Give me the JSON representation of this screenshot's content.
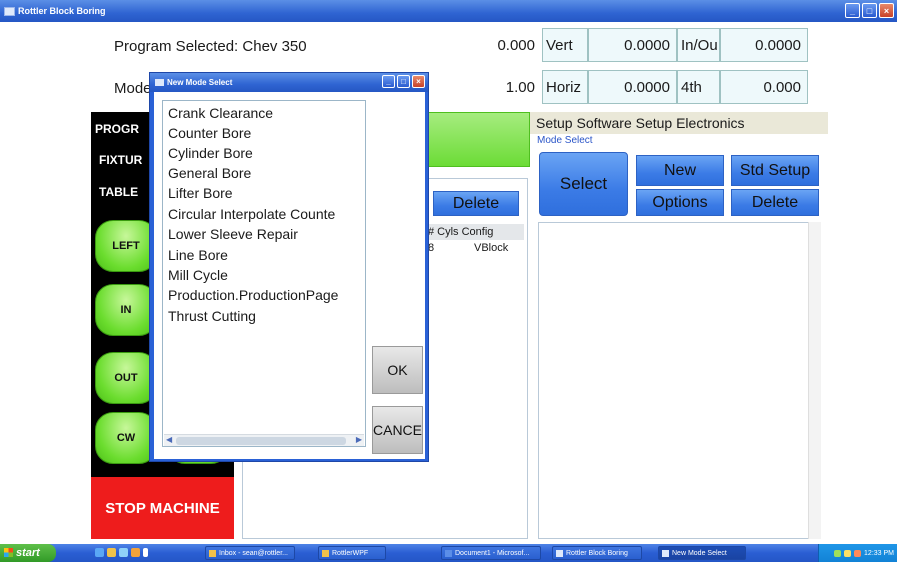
{
  "window": {
    "title": "Rottler Block Boring"
  },
  "header": {
    "program_label": "Program Selected: Chev 350",
    "mode_label": "Mode"
  },
  "readout": {
    "row1": {
      "v1": "0.000",
      "l1": "Vert",
      "v2": "0.0000",
      "l2": "In/Ou",
      "v3": "0.0000"
    },
    "row2": {
      "v1": "1.00",
      "l1": "Horiz",
      "v2": "0.0000",
      "l2": "4th",
      "v3": "0.000"
    }
  },
  "axis_panel": {
    "side_labels": [
      "PROGR",
      "FIXTUR",
      "TABLE"
    ],
    "jog_buttons": [
      "LEFT",
      "IN",
      "OUT",
      "CW"
    ],
    "stop_label": "STOP MACHINE"
  },
  "center": {
    "delete_label": "Delete",
    "col_header": "# Cyls  Config",
    "row1_cyls": "8",
    "row1_config": "VBlock"
  },
  "right": {
    "tabs": "Setup Software  Setup Electronics",
    "mode_select_label": "Mode Select",
    "buttons": {
      "select": "Select",
      "new": "New",
      "std_setup": "Std Setup",
      "options": "Options",
      "delete": "Delete"
    }
  },
  "dialog": {
    "title": "New Mode Select",
    "items": [
      "Crank Clearance",
      "Counter Bore",
      "Cylinder Bore",
      "General Bore",
      "Lifter Bore",
      "Circular Interpolate Counte",
      "Lower Sleeve Repair",
      "Line Bore",
      "Mill Cycle",
      "Production.ProductionPage",
      "Thrust Cutting"
    ],
    "ok_label": "OK",
    "cancel_label": "CANCE"
  },
  "taskbar": {
    "start_label": "start",
    "tasks": [
      "Inbox - sean@rottler...",
      "RottlerWPF",
      "Document1 - Microsof...",
      "Rottler Block Boring",
      "New Mode Select"
    ],
    "clock": "12:33 PM"
  }
}
